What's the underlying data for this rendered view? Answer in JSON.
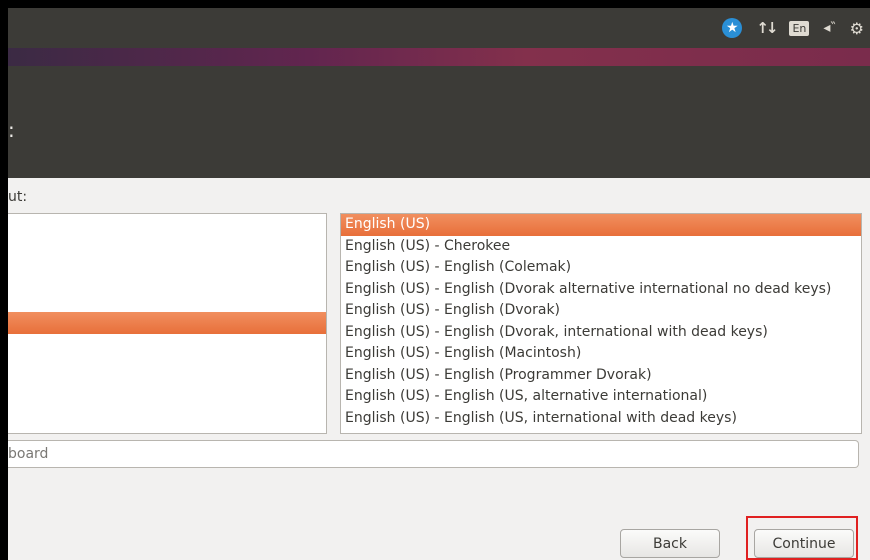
{
  "panel": {
    "language_indicator": "En",
    "icons": [
      "accessibility-icon",
      "network-icon",
      "keyboard-language-icon",
      "sound-icon",
      "settings-gear-icon"
    ]
  },
  "header": {
    "title": ":"
  },
  "layout_label": "ut:",
  "variants": {
    "items": [
      "English (US)",
      "English (US) - Cherokee",
      "English (US) - English (Colemak)",
      "English (US) - English (Dvorak alternative international no dead keys)",
      "English (US) - English (Dvorak)",
      "English (US) - English (Dvorak, international with dead keys)",
      "English (US) - English (Macintosh)",
      "English (US) - English (Programmer Dvorak)",
      "English (US) - English (US, alternative international)",
      "English (US) - English (US, international with dead keys)"
    ],
    "selected_index": 0
  },
  "test_input": {
    "placeholder": "board"
  },
  "buttons": {
    "back": "Back",
    "continue": "Continue"
  },
  "colors": {
    "accent": "#e95420",
    "panel": "#3c3b37",
    "highlight": "#e02020"
  }
}
